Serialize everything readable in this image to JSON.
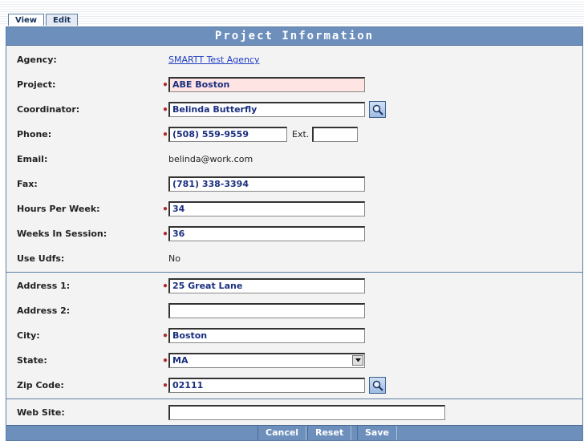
{
  "tabs": [
    {
      "label": "View",
      "active": false
    },
    {
      "label": "Edit",
      "active": true
    }
  ],
  "header": {
    "title": "Project Information"
  },
  "fields": {
    "agency": {
      "label": "Agency:",
      "value": "SMARTT Test Agency"
    },
    "project": {
      "label": "Project:",
      "value": "ABE Boston",
      "required": true
    },
    "coordinator": {
      "label": "Coordinator:",
      "value": "Belinda Butterfly",
      "required": true
    },
    "phone": {
      "label": "Phone:",
      "value": "(508) 559-9559",
      "required": true,
      "ext_label": "Ext.",
      "ext_value": ""
    },
    "email": {
      "label": "Email:",
      "value": "belinda@work.com"
    },
    "fax": {
      "label": "Fax:",
      "value": "(781) 338-3394"
    },
    "hours_per_week": {
      "label": "Hours Per Week:",
      "value": "34",
      "required": true
    },
    "weeks_in_session": {
      "label": "Weeks In Session:",
      "value": "36",
      "required": true
    },
    "use_udfs": {
      "label": "Use Udfs:",
      "value": "No"
    },
    "address1": {
      "label": "Address 1:",
      "value": "25 Great Lane",
      "required": true
    },
    "address2": {
      "label": "Address 2:",
      "value": ""
    },
    "city": {
      "label": "City:",
      "value": "Boston",
      "required": true
    },
    "state": {
      "label": "State:",
      "value": "MA",
      "required": true
    },
    "zip": {
      "label": "Zip Code:",
      "value": "02111",
      "required": true
    },
    "website": {
      "label": "Web Site:",
      "value": ""
    }
  },
  "icons": {
    "lookup": "magnifier-icon",
    "dropdown": "chevron-down-icon",
    "required": "required-dot-icon"
  },
  "actions": {
    "cancel_label": "Cancel",
    "reset_label": "Reset",
    "save_label": "Save"
  },
  "colors": {
    "header_bg": "#6d8fbc",
    "required_marker": "#b0282f",
    "field_text": "#1a2f80",
    "highlight_bg": "#ffe4e4"
  }
}
